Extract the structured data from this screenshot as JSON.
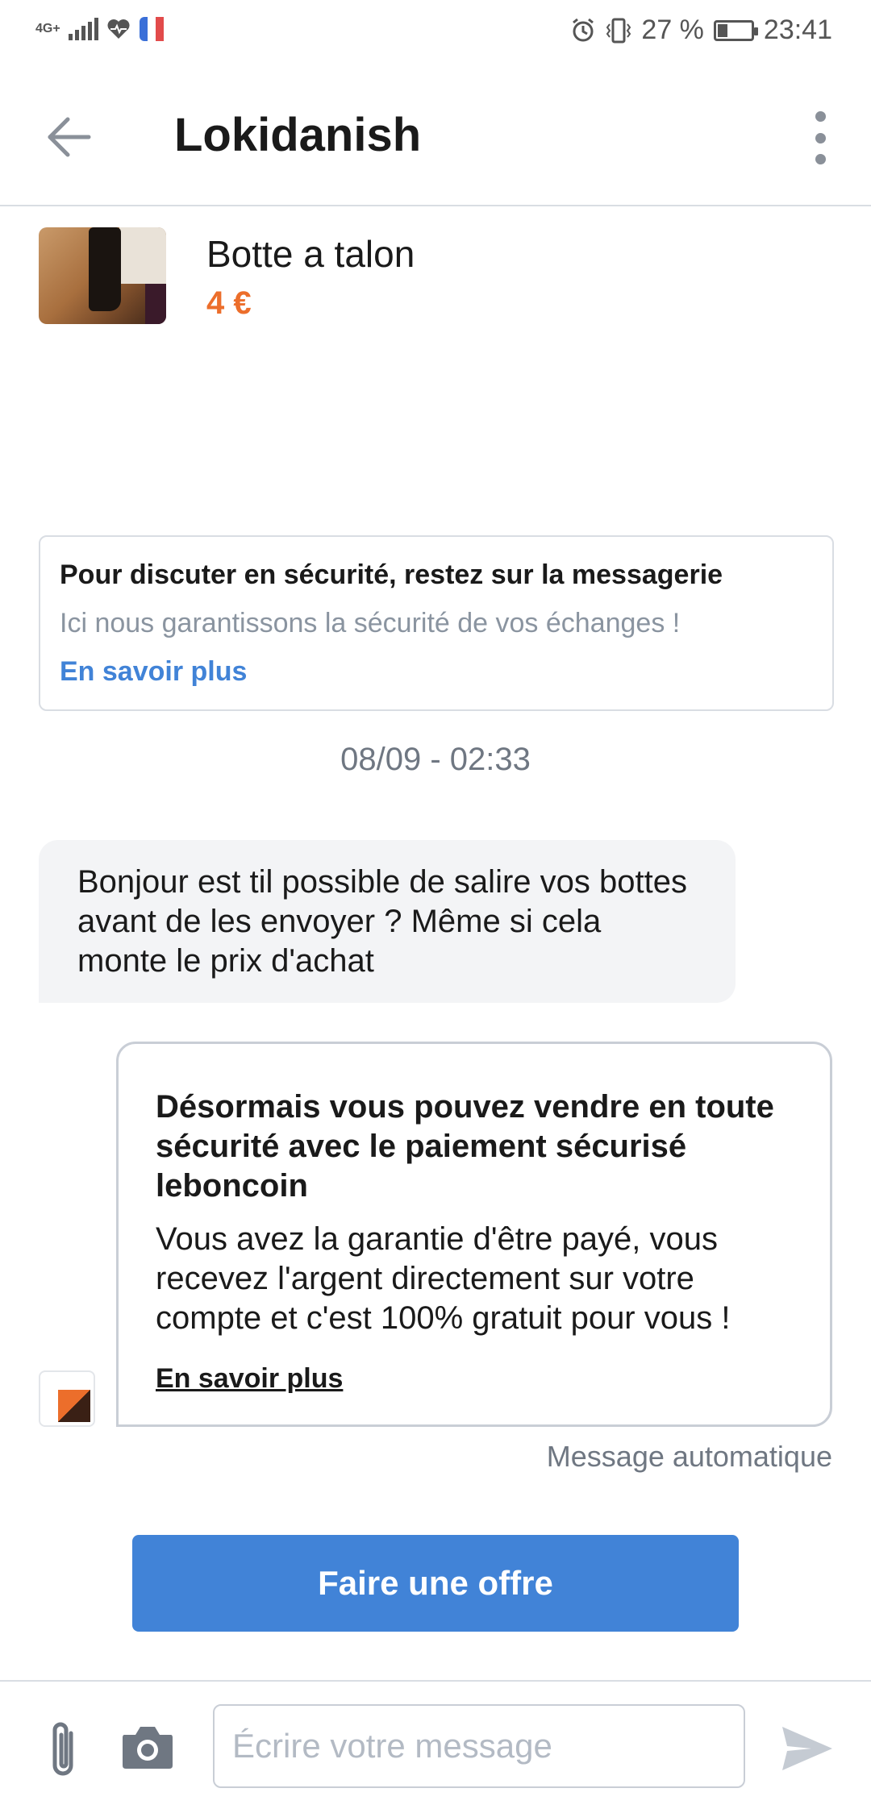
{
  "status_bar": {
    "network": "4G+",
    "battery_percent": "27 %",
    "battery_level": 0.27,
    "time": "23:41",
    "icons": [
      "signal-icon",
      "health-icon",
      "flag-app-icon",
      "alarm-icon",
      "vibrate-icon",
      "battery-icon"
    ]
  },
  "header": {
    "title": "Lokidanish"
  },
  "listing": {
    "title": "Botte a talon",
    "price": "4 €"
  },
  "safety_notice": {
    "title": "Pour discuter en sécurité, restez sur la messagerie",
    "subtitle": "Ici nous garantissons la sécurité de vos échanges !",
    "link": "En savoir plus"
  },
  "conversation": {
    "timestamp": "08/09 - 02:33",
    "messages": [
      {
        "text": "Bonjour est til possible de salire vos bottes avant de les envoyer ? Même si cela monte le prix d'achat"
      }
    ],
    "auto_message": {
      "title": "Désormais vous pouvez vendre en toute sécurité avec le paiement sécurisé leboncoin",
      "body": "Vous avez la garantie d'être payé, vous recevez l'argent directement sur votre compte et c'est 100% gratuit pour vous !",
      "link": "En savoir plus",
      "label": "Message automatique"
    }
  },
  "actions": {
    "offer_label": "Faire une offre"
  },
  "composer": {
    "placeholder": "Écrire votre message"
  },
  "colors": {
    "accent": "#4183d7",
    "price": "#ec6e2b",
    "muted": "#8a94a0"
  }
}
